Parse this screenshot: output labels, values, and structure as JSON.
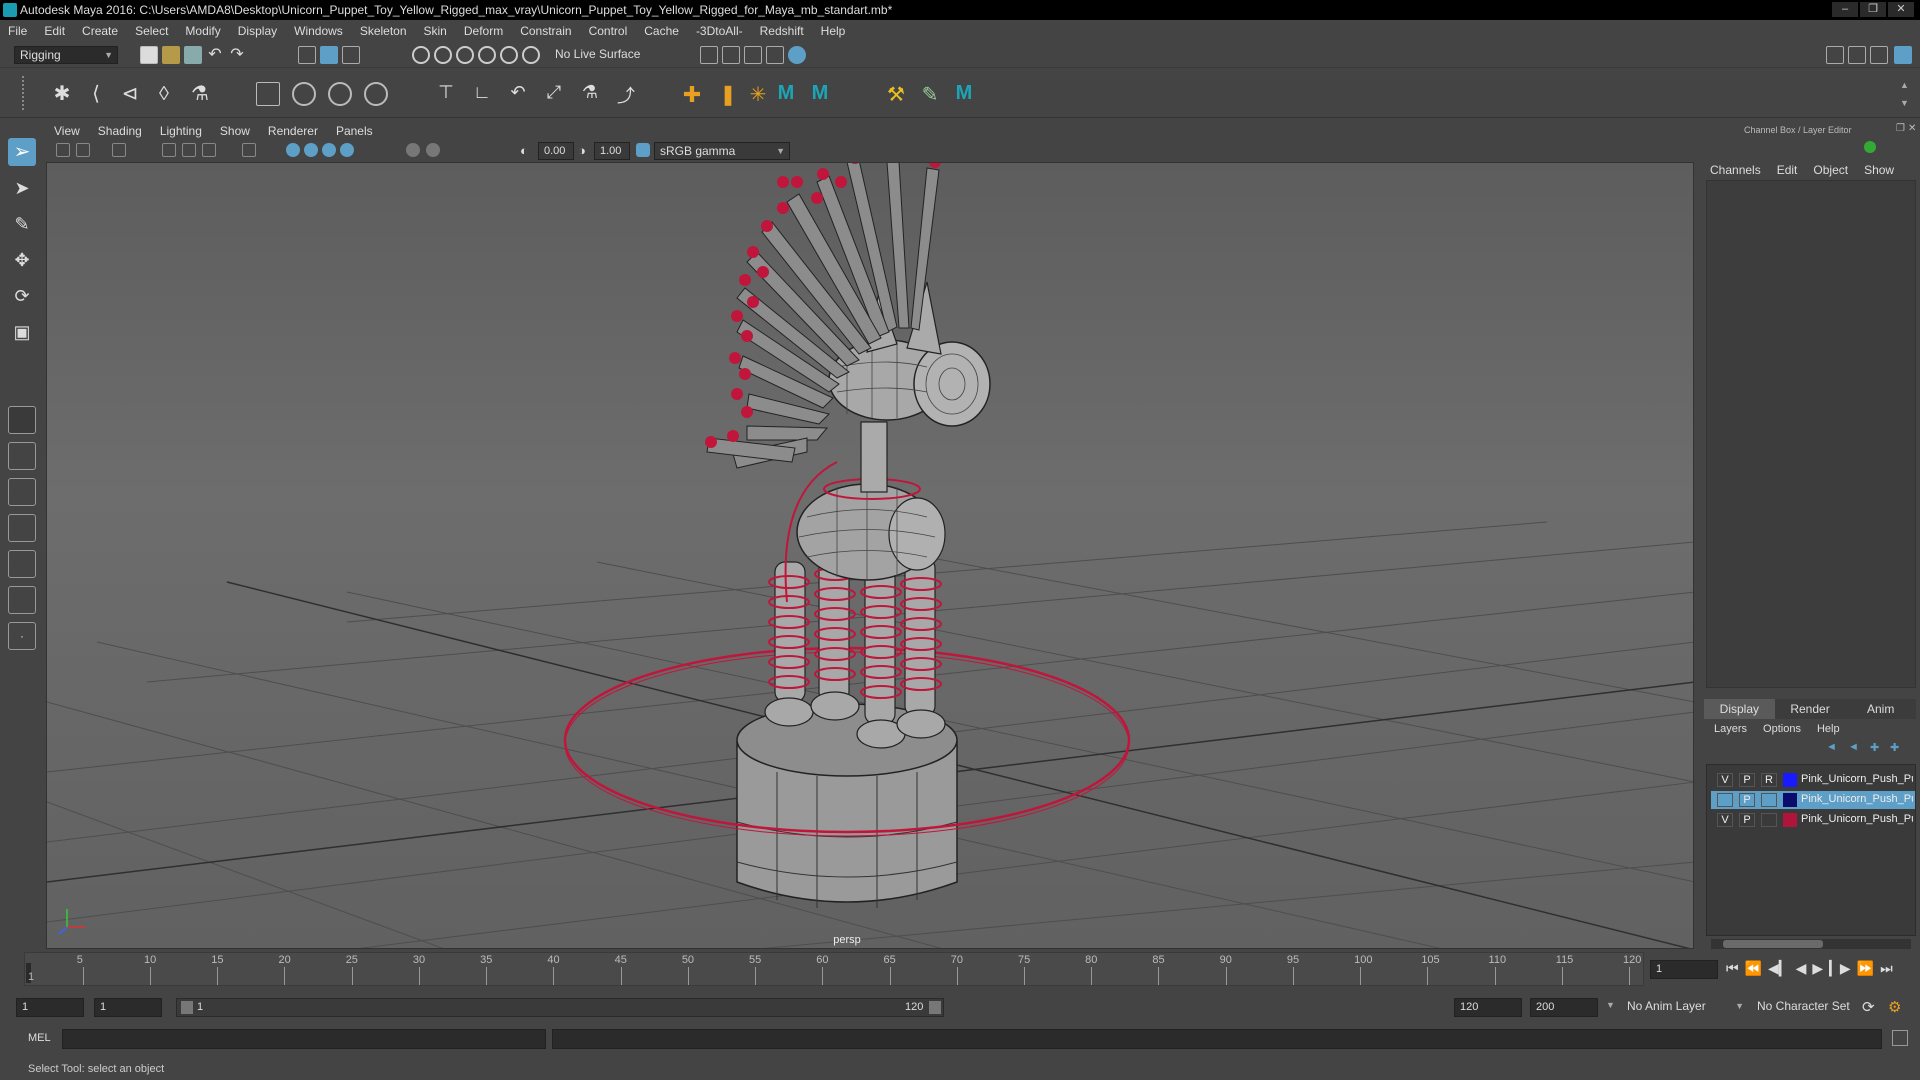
{
  "window": {
    "title": "Autodesk Maya 2016: C:\\Users\\AMDA8\\Desktop\\Unicorn_Puppet_Toy_Yellow_Rigged_max_vray\\Unicorn_Puppet_Toy_Yellow_Rigged_for_Maya_mb_standart.mb*"
  },
  "menubar": [
    "File",
    "Edit",
    "Create",
    "Select",
    "Modify",
    "Display",
    "Windows",
    "Skeleton",
    "Skin",
    "Deform",
    "Constrain",
    "Control",
    "Cache",
    "-3DtoAll-",
    "Redshift",
    "Help"
  ],
  "statusline": {
    "menuset": "Rigging",
    "live_surface": "No Live Surface"
  },
  "panel": {
    "menus": [
      "View",
      "Shading",
      "Lighting",
      "Show",
      "Renderer",
      "Panels"
    ],
    "exposure": "0.00",
    "gamma": "1.00",
    "colorspace": "sRGB gamma",
    "camera_label": "persp"
  },
  "channelbox": {
    "title": "Channel Box / Layer Editor",
    "menus": [
      "Channels",
      "Edit",
      "Object",
      "Show"
    ],
    "layer_tabs": [
      "Display",
      "Render",
      "Anim"
    ],
    "layer_menus": [
      "Layers",
      "Options",
      "Help"
    ],
    "layers": [
      {
        "v": "V",
        "p": "P",
        "r": "R",
        "color": "#1a1aff",
        "name": "Pink_Unicorn_Push_Pu",
        "selected": false
      },
      {
        "v": "",
        "p": "P",
        "r": "",
        "color": "#0b0b6e",
        "name": "Pink_Unicorn_Push_Pu",
        "selected": true
      },
      {
        "v": "V",
        "p": "P",
        "r": "",
        "color": "#b0143a",
        "name": "Pink_Unicorn_Push_Pu",
        "selected": false
      }
    ]
  },
  "timeline": {
    "ticks": [
      "5",
      "10",
      "15",
      "20",
      "25",
      "30",
      "35",
      "40",
      "45",
      "50",
      "55",
      "60",
      "65",
      "70",
      "75",
      "80",
      "85",
      "90",
      "95",
      "100",
      "105",
      "110",
      "115",
      "120"
    ],
    "first_tick": "1",
    "current_frame": "1"
  },
  "range": {
    "start": "1",
    "playback_start": "1",
    "slider_start": "1",
    "slider_end": "120",
    "playback_end": "120",
    "end": "200",
    "anim_layer": "No Anim Layer",
    "character_set": "No Character Set"
  },
  "cmdline": {
    "label": "MEL"
  },
  "helpline": {
    "text": "Select Tool: select an object"
  },
  "colors": {
    "rig_red": "#c0163c",
    "accent_blue": "#5d9fc7",
    "teal": "#1aa6b7"
  }
}
